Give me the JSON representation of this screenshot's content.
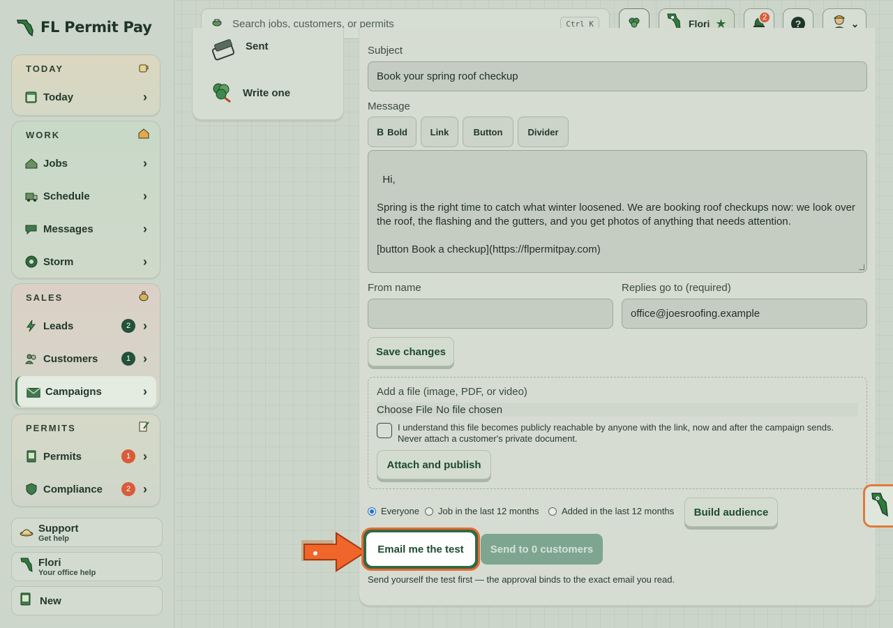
{
  "app": {
    "name": "FL Permit Pay"
  },
  "sidebar": {
    "groups": [
      {
        "title": "TODAY",
        "items": [
          {
            "label": "Today",
            "badge": null
          }
        ]
      },
      {
        "title": "WORK",
        "items": [
          {
            "label": "Jobs",
            "badge": null
          },
          {
            "label": "Schedule",
            "badge": null
          },
          {
            "label": "Messages",
            "badge": null
          },
          {
            "label": "Storm",
            "badge": null
          }
        ]
      },
      {
        "title": "SALES",
        "items": [
          {
            "label": "Leads",
            "badge": "2"
          },
          {
            "label": "Customers",
            "badge": "1"
          },
          {
            "label": "Campaigns",
            "badge": null
          }
        ]
      },
      {
        "title": "PERMITS",
        "items": [
          {
            "label": "Permits",
            "badge": "1"
          },
          {
            "label": "Compliance",
            "badge": "2"
          }
        ]
      }
    ],
    "support": {
      "title": "Support",
      "sub": "Get help"
    },
    "flori": {
      "title": "Flori",
      "sub": "Your office help"
    },
    "new": {
      "title": "New"
    }
  },
  "topbar": {
    "search_placeholder": "Search jobs, customers, or permits",
    "shortcut": "Ctrl K",
    "assistant_label": "Flori",
    "notifications_count": "2",
    "help_glyph": "?"
  },
  "subpanel": {
    "items": [
      {
        "label": "Sent"
      },
      {
        "label": "Write one"
      }
    ]
  },
  "editor": {
    "subject_label": "Subject",
    "subject_value": "Book your spring roof checkup",
    "message_label": "Message",
    "toolbar": {
      "bold_glyph": "B",
      "bold": "Bold",
      "link": "Link",
      "button": "Button",
      "divider": "Divider"
    },
    "message_body": "Hi,\n\nSpring is the right time to catch what winter loosened. We are booking roof checkups now: we look over the roof, the flashing and the gutters, and you get photos of anything that needs attention.\n\n[button Book a checkup](https://flpermitpay.com)",
    "from_name_label": "From name",
    "from_name_value": "",
    "replies_label": "Replies go to (required)",
    "replies_value": "office@joesroofing.example",
    "save_label": "Save changes",
    "file": {
      "label": "Add a file (image, PDF, or video)",
      "choose_button": "Choose File",
      "status": "No file chosen",
      "consent_line1": "I understand this file becomes publicly reachable by anyone with the link, now and after the campaign sends.",
      "consent_line2": "Never attach a customer's private document.",
      "attach_label": "Attach and publish"
    },
    "audience": {
      "options": [
        "Everyone",
        "Job in the last 12 months",
        "Added in the last 12 months"
      ],
      "selected": "Everyone",
      "build_label": "Build audience"
    },
    "test_label": "Email me the test",
    "send_label": "Send to 0 customers",
    "hint": "Send yourself the test first — the approval binds to the exact email you read."
  },
  "colors": {
    "accent": "#1e4a30",
    "send_button": "#7ea590",
    "highlight_arrow": "#f0652a",
    "badge_red": "#d95c3a",
    "badge_green": "#23513a"
  }
}
